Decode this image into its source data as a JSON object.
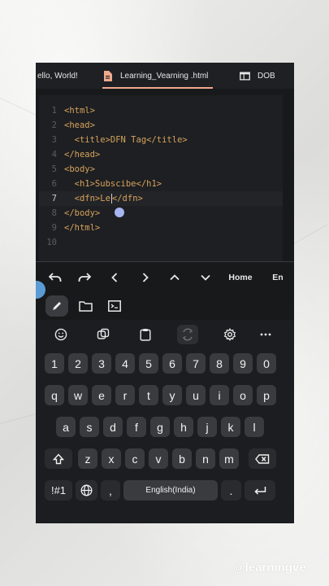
{
  "tabs": [
    {
      "label": "ello, World!",
      "icon": "none",
      "active": false
    },
    {
      "label": "Learning_Vearning .html",
      "icon": "document-icon",
      "active": true
    },
    {
      "label": "DOB",
      "icon": "window-icon",
      "active": false
    }
  ],
  "editor": {
    "lines": [
      {
        "num": "1",
        "code": "<html>"
      },
      {
        "num": "2",
        "code": "<head>"
      },
      {
        "num": "3",
        "code": "  <title>DFN Tag</title>"
      },
      {
        "num": "4",
        "code": "</head>"
      },
      {
        "num": "5",
        "code": "<body>"
      },
      {
        "num": "6",
        "code": "  <h1>Subscibe</h1>"
      },
      {
        "num": "7",
        "code_before": "  <dfn>Le",
        "code_after": "</dfn>",
        "current": true
      },
      {
        "num": "8",
        "code": "</body>"
      },
      {
        "num": "9",
        "code": "</html>"
      },
      {
        "num": "10",
        "code": ""
      }
    ]
  },
  "extra_keys": {
    "home": "Home",
    "end": "En",
    "icons": [
      "undo-icon",
      "redo-icon",
      "chevron-left-icon",
      "chevron-right-icon",
      "chevron-up-icon",
      "chevron-down-icon"
    ]
  },
  "app_tools": [
    "pencil-icon",
    "folder-icon",
    "terminal-icon"
  ],
  "keyboard": {
    "suggestion_icons": [
      "emoji-icon",
      "sticker-icon",
      "clipboard-icon",
      "translate-icon",
      "settings-icon",
      "more-icon"
    ],
    "row_numbers": [
      "1",
      "2",
      "3",
      "4",
      "5",
      "6",
      "7",
      "8",
      "9",
      "0"
    ],
    "row_1": [
      "q",
      "w",
      "e",
      "r",
      "t",
      "y",
      "u",
      "i",
      "o",
      "p"
    ],
    "row_2": [
      "a",
      "s",
      "d",
      "f",
      "g",
      "h",
      "j",
      "k",
      "l"
    ],
    "row_3": [
      "z",
      "x",
      "c",
      "v",
      "b",
      "n",
      "m"
    ],
    "symbols_label": "!#1",
    "comma_label": ",",
    "space_label": "English(India)",
    "period_label": "."
  },
  "watermark": "@learningve",
  "colors": {
    "accent": "#f0a98f",
    "handle": "#a8b5f2",
    "keyword": "#d6a35d"
  }
}
